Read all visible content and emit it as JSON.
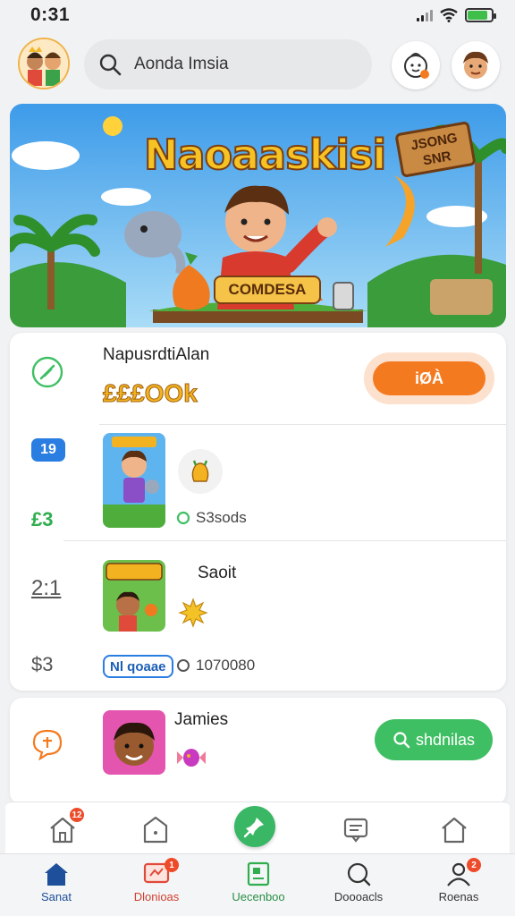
{
  "status_bar": {
    "time": "0:31",
    "battery_percent": 85
  },
  "search": {
    "value": "Aonda Imsia"
  },
  "banner": {
    "title": "Naoaaskisi",
    "subtitle": "COMDESA",
    "sign_text": "JSONG\nSNR"
  },
  "feed": {
    "featured": {
      "title": "NapusrdtiAlan",
      "price": "£££OOk",
      "button_label": "iØÀ"
    },
    "item1": {
      "left_badge": "19",
      "left_value": "£3",
      "meta": "S3sods"
    },
    "item2": {
      "left_top": "2:1",
      "left_bottom": "$3",
      "title": "Saoit",
      "chip": "Nl qoaae",
      "meta": "1070080"
    },
    "item3": {
      "title": "Jamies",
      "button_label": "shdnilas"
    }
  },
  "tabs": [
    {
      "label": "Sanat",
      "icon": "home-icon",
      "active": true
    },
    {
      "label": "Dlonioas",
      "icon": "chat-icon",
      "badge": "1"
    },
    {
      "label": "Uecenboo",
      "icon": "document-icon"
    },
    {
      "label": "Doooacls",
      "icon": "search-icon"
    },
    {
      "label": "Roenas",
      "icon": "profile-icon",
      "badge": "2"
    }
  ],
  "toolbar": {
    "home_badge": "12"
  },
  "colors": {
    "accent_orange": "#f47a20",
    "accent_green": "#3fbf63",
    "accent_blue": "#2a7de1",
    "tab_active": "#1d4f9a"
  }
}
